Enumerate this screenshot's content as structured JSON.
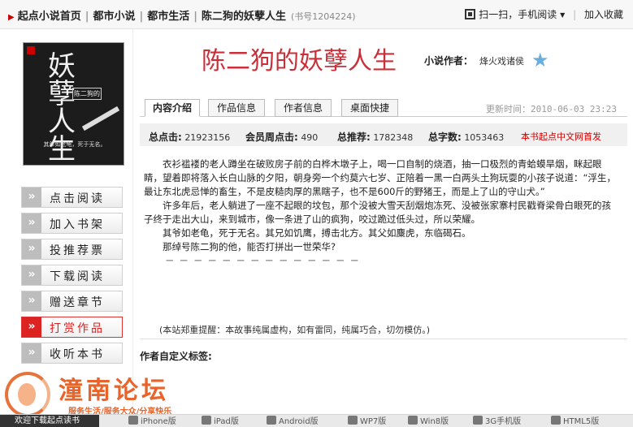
{
  "breadcrumb": {
    "items": [
      "起点小说首页",
      "都市小说",
      "都市生活",
      "陈二狗的妖孽人生"
    ],
    "book_no": "(书号1204224)"
  },
  "topbar": {
    "scan": "扫一扫，手机阅读",
    "bookmark": "加入收藏"
  },
  "cover": {
    "big_title": "妖孽人生",
    "subtitle": "陈二狗的",
    "tagline": "其爹如老龟，死于无名。"
  },
  "sidebar": {
    "items": [
      {
        "label": "点击阅读"
      },
      {
        "label": "加入书架"
      },
      {
        "label": "投推荐票"
      },
      {
        "label": "下载阅读"
      },
      {
        "label": "赠送章节"
      },
      {
        "label": "打赏作品"
      },
      {
        "label": "收听本书"
      }
    ]
  },
  "book": {
    "title": "陈二狗的妖孽人生",
    "author_label": "小说作者：",
    "author": "烽火戏诸侯"
  },
  "tabs": [
    "内容介绍",
    "作品信息",
    "作者信息",
    "桌面快捷"
  ],
  "updated": "更新时间：2010-06-03 23:23",
  "stats": {
    "clicks_label": "总点击:",
    "clicks": "21923156",
    "member_clicks_label": "会员周点击:",
    "member_clicks": "490",
    "recommend_label": "总推荐:",
    "recommend": "1782348",
    "words_label": "总字数:",
    "words": "1053463",
    "first_pub": "本书起点中文网首发"
  },
  "intro": {
    "p1": "衣衫褴褛的老人蹲坐在破败房子前的白桦木墩子上，喝一口自制的烧酒，抽一口极烈的青蛤蟆旱烟，眯起眼睛，望着即将落入长白山脉的夕阳，朝身旁一个约莫六七岁、正陪着一黑一白两头土狗玩耍的小孩子说道：“浮生，最让东北虎忌惮的畜生，不是皮糙肉厚的黑瞎子，也不是600斤的野猪王，而是上了山的守山犬。”",
    "p2": "许多年后，老人躺进了一座不起眼的坟包，那个没被大雪天刮烟炮冻死、没被张家寨村民戳脊梁骨白眼死的孩子终于走出大山，来到城市，像一条进了山的疯狗，咬过跪过低头过，所以荣耀。",
    "p3": "其爷如老龟，死于无名。其兄如饥鹰，搏击北方。其父如麋虎，东临碣石。",
    "p4": "那绰号陈二狗的他，能否打拼出一世荣华?",
    "dashes": "－－－－－－－－－－－－－－"
  },
  "notice": "(本站郑重提醒：本故事纯属虚构，如有雷同，纯属巧合，切勿模仿。)",
  "custom_tags_label": "作者自定义标签:",
  "watermark": {
    "brand": "潼南论坛",
    "slogan": "服务生活/服务大众/分享快乐"
  },
  "footer": {
    "download": "欢迎下载起点读书",
    "platforms": [
      "iPhone版",
      "iPad版",
      "Android版",
      "WP7版",
      "Win8版",
      "3G手机版",
      "HTML5版"
    ]
  }
}
